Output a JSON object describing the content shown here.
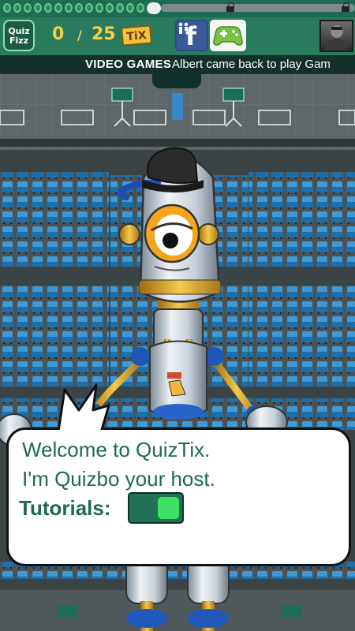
{
  "header": {
    "logo_text_top": "Quiz",
    "logo_text_bottom": "Fizz",
    "tix_count": "0",
    "tix_slash": "/",
    "tix_total": "25",
    "tix_badge": "TiX"
  },
  "news_ticker": {
    "category": "VIDEO GAMES",
    "text": "Albert came back to play Gam"
  },
  "bubble": {
    "line1": "Welcome to QuizTix.",
    "line2": "I'm Quizbo your host.",
    "tutorials_label": "Tutorials:"
  },
  "tutorials_toggle": {
    "on": true
  },
  "colors": {
    "accent_green": "#2a7a5d",
    "tix_gold": "#f7ce45",
    "text_green": "#1c6a52",
    "toggle_on": "#3ee064",
    "seat_blue": "#2d86c4"
  },
  "icons": [
    "facebook-icon",
    "google-play-games-icon",
    "lock-icon"
  ]
}
